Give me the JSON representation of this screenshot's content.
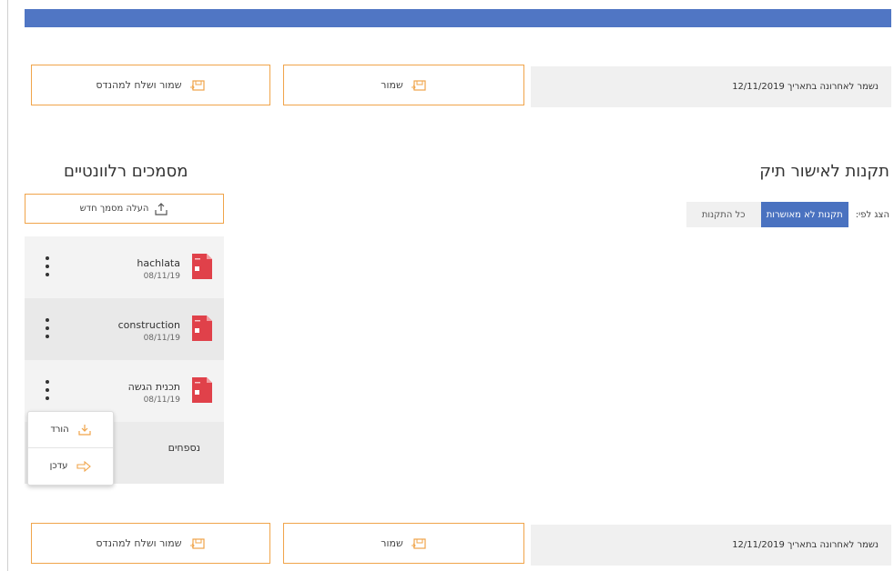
{
  "header": {
    "bar_color": "#5076c4"
  },
  "action_bar_top": {
    "save_and_send_label": "שמור ושלח למהנדס",
    "save_label": "שמור",
    "last_saved_text": "נשמר לאחרונה בתאריך 12/11/2019"
  },
  "approval": {
    "title": "תקנות לאישור תיק",
    "filter_label": "הצג לפי:",
    "filter_options": [
      {
        "label": "תקנות לא מאושרות",
        "active": true
      },
      {
        "label": "כל התקנות",
        "active": false
      }
    ]
  },
  "documents": {
    "title": "מסמכים רלוונטיים",
    "upload_label": "העלה מסמך חדש",
    "items": [
      {
        "name": "hachlata",
        "date": "08/11/19"
      },
      {
        "name": "construction",
        "date": "08/11/19"
      },
      {
        "name": "תכנית הגשה",
        "date": "08/11/19"
      }
    ],
    "more_label": "נספחים",
    "menu": {
      "download_label": "הורד",
      "update_label": "עדכן"
    }
  },
  "action_bar_bottom": {
    "save_and_send_label": "שמור ושלח למהנדס",
    "save_label": "שמור",
    "last_saved_text": "נשמר לאחרונה בתאריך 12/11/2019"
  },
  "colors": {
    "accent_orange": "#f0a44a",
    "primary_blue": "#4a72c0",
    "doc_red": "#e0414a"
  },
  "icons": [
    "save-send-icon",
    "save-icon",
    "upload-icon",
    "pdf-file-icon",
    "kebab-icon",
    "download-icon",
    "update-arrow-icon"
  ]
}
